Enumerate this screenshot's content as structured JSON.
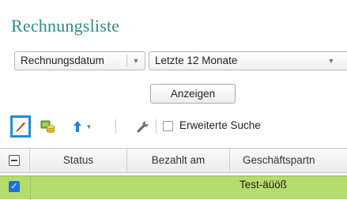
{
  "page": {
    "title": "Rechnungsliste"
  },
  "filters": {
    "date_field": {
      "value": "Rechnungsdatum"
    },
    "period": {
      "value": "Letzte 12 Monate"
    },
    "show_button": "Anzeigen"
  },
  "toolbar": {
    "edit_icon": "pencil-icon",
    "payment_icon": "coins-icon",
    "upload_icon": "upload-arrow-icon",
    "settings_icon": "wrench-icon",
    "advanced_search_label": "Erweiterte Suche",
    "advanced_search_checked": false,
    "highlight_color": "#1e8fd6"
  },
  "table": {
    "columns": [
      "Status",
      "Bezahlt am",
      "Geschäftspartn"
    ],
    "rows": [
      {
        "selected": true,
        "status": "",
        "paid_on": "",
        "partner": "Test-äüöß"
      }
    ],
    "row_highlight_color": "#b5dc6c"
  }
}
